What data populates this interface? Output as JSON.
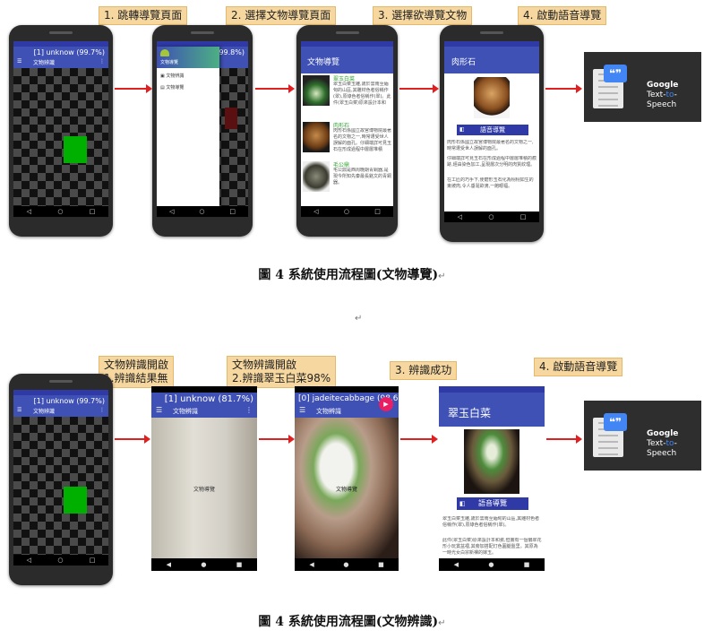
{
  "figure1": {
    "steps": [
      "1. 跳轉導覽頁面",
      "2. 選擇文物導覽頁面",
      "3. 選擇欲導覽文物",
      "4. 啟動語音導覽"
    ],
    "phone1": {
      "overlay": "[1] unknow (99.7%)",
      "title": "文物辨識"
    },
    "phone2": {
      "overlay": "[1] unknow (99.8%)",
      "drawer_items": [
        "文物辨識",
        "文物導覽"
      ],
      "drawer_title": "文物導覽"
    },
    "phone3": {
      "title": "文物導覽",
      "items": [
        {
          "name": "翠玉白菜",
          "desc": "翠玉白菜玉雕,歲於雲南至緬甸的山區,其雕材色者俗稱作(翠),原綠色者俗稱作(翠)。此件(翠玉白菜)原來設計本和"
        },
        {
          "name": "肉形石",
          "desc": "肉形石係國立故宮博物院最著名的文物之一,時常遭受世人誤解的面孔。仔細端詳可見玉石在形成過程中層層堆積"
        },
        {
          "name": "毛公鼎",
          "desc": "毛公鼎是西周晚期青銅器,是現今所知先秦最長銘文的青銅器。"
        }
      ]
    },
    "phone4": {
      "title": "肉形石",
      "button": "語音導覽",
      "paragraphs": [
        "肉形石係國立故宮博物院最著名的文物之一,時常遭受世人誤解的面孔。",
        "仔細端詳可見玉石在形成過程中層層堆積的痕跡,經由染色加工,呈現層次分明的肉質紋理。",
        "在工匠的巧手下,使磨形玉石化為栩栩如生的東坡肉,令人垂涎欲滴,一飽眼福。"
      ]
    },
    "tts": {
      "logo": "Google",
      "product_a": "Text-",
      "product_b": "to",
      "product_c": "-Speech"
    },
    "caption": "圖 4 系統使用流程圖(文物導覽)",
    "marks": [
      "↵",
      "↵"
    ]
  },
  "figure2": {
    "steps": [
      "文物辨識開啟\n1.辨識結果無",
      "文物辨識開啟\n2.辨識翠玉白菜98%",
      "3. 辨識成功",
      "4. 啟動語音導覽"
    ],
    "phone1": {
      "overlay": "[1] unknow (99.7%)",
      "title": "文物辨識"
    },
    "phone2": {
      "overlay": "[1] unknow (81.7%)",
      "title": "文物辨識",
      "center": "文物導覽"
    },
    "phone3": {
      "overlay": "[0] jadeitecabbage (98.6%)",
      "title": "文物辨識",
      "center": "文物導覽"
    },
    "phone4": {
      "title": "翠玉白菜",
      "button": "語音導覽",
      "paragraphs": [
        "翠玉白菜玉雕,歲於雲南至緬甸的山區,其雕材色者俗稱作(翠),原綠色者俗稱作(翠)。",
        "此件(翠玉白菜)原來設計本和瓷,但擁有一個偏翠花形小玩賞盆裡,其旁加搭配灯色圓腿盤里。其原為一時光女白宗新裸的嫁玉。"
      ]
    },
    "tts": {
      "logo": "Google",
      "product_a": "Text-",
      "product_b": "to",
      "product_c": "-Speech"
    },
    "caption": "圖 4 系統使用流程圖(文物辨識)",
    "marks": [
      "↵"
    ]
  },
  "colors": {
    "appbar": "#3f51b5",
    "arrow": "#e02020",
    "step_bg": "#f6d79f",
    "green": "#00b000",
    "tts_bg": "#2e2e2e",
    "google_blue": "#4285f4"
  }
}
